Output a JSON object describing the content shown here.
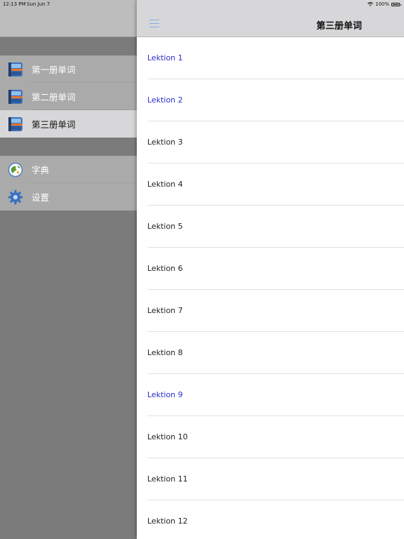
{
  "status_bar": {
    "time": "12:13 PM",
    "date": "Sun Jun 7",
    "battery": "100%"
  },
  "sidebar": {
    "books": [
      {
        "label": "第一册单词",
        "icon": "book-icon",
        "selected": false
      },
      {
        "label": "第二册单词",
        "icon": "book-icon",
        "selected": false
      },
      {
        "label": "第三册单词",
        "icon": "book-icon",
        "selected": true
      }
    ],
    "tools": [
      {
        "label": "字典",
        "icon": "dictionary-icon"
      },
      {
        "label": "设置",
        "icon": "gear-icon"
      }
    ]
  },
  "main": {
    "title": "第三册单词",
    "menu_icon": "hamburger-menu-icon",
    "lessons": [
      {
        "label": "Lektion 1",
        "visited": true
      },
      {
        "label": "Lektion 2",
        "visited": true
      },
      {
        "label": "Lektion 3",
        "visited": false
      },
      {
        "label": "Lektion 4",
        "visited": false
      },
      {
        "label": "Lektion 5",
        "visited": false
      },
      {
        "label": "Lektion 6",
        "visited": false
      },
      {
        "label": "Lektion 7",
        "visited": false
      },
      {
        "label": "Lektion 8",
        "visited": false
      },
      {
        "label": "Lektion 9",
        "visited": true
      },
      {
        "label": "Lektion 10",
        "visited": false
      },
      {
        "label": "Lektion 11",
        "visited": false
      },
      {
        "label": "Lektion 12",
        "visited": false
      }
    ]
  },
  "colors": {
    "visited_link": "#2c2cc8",
    "menu_icon": "#86aee0",
    "sidebar_selected": "#d7d7d9"
  }
}
